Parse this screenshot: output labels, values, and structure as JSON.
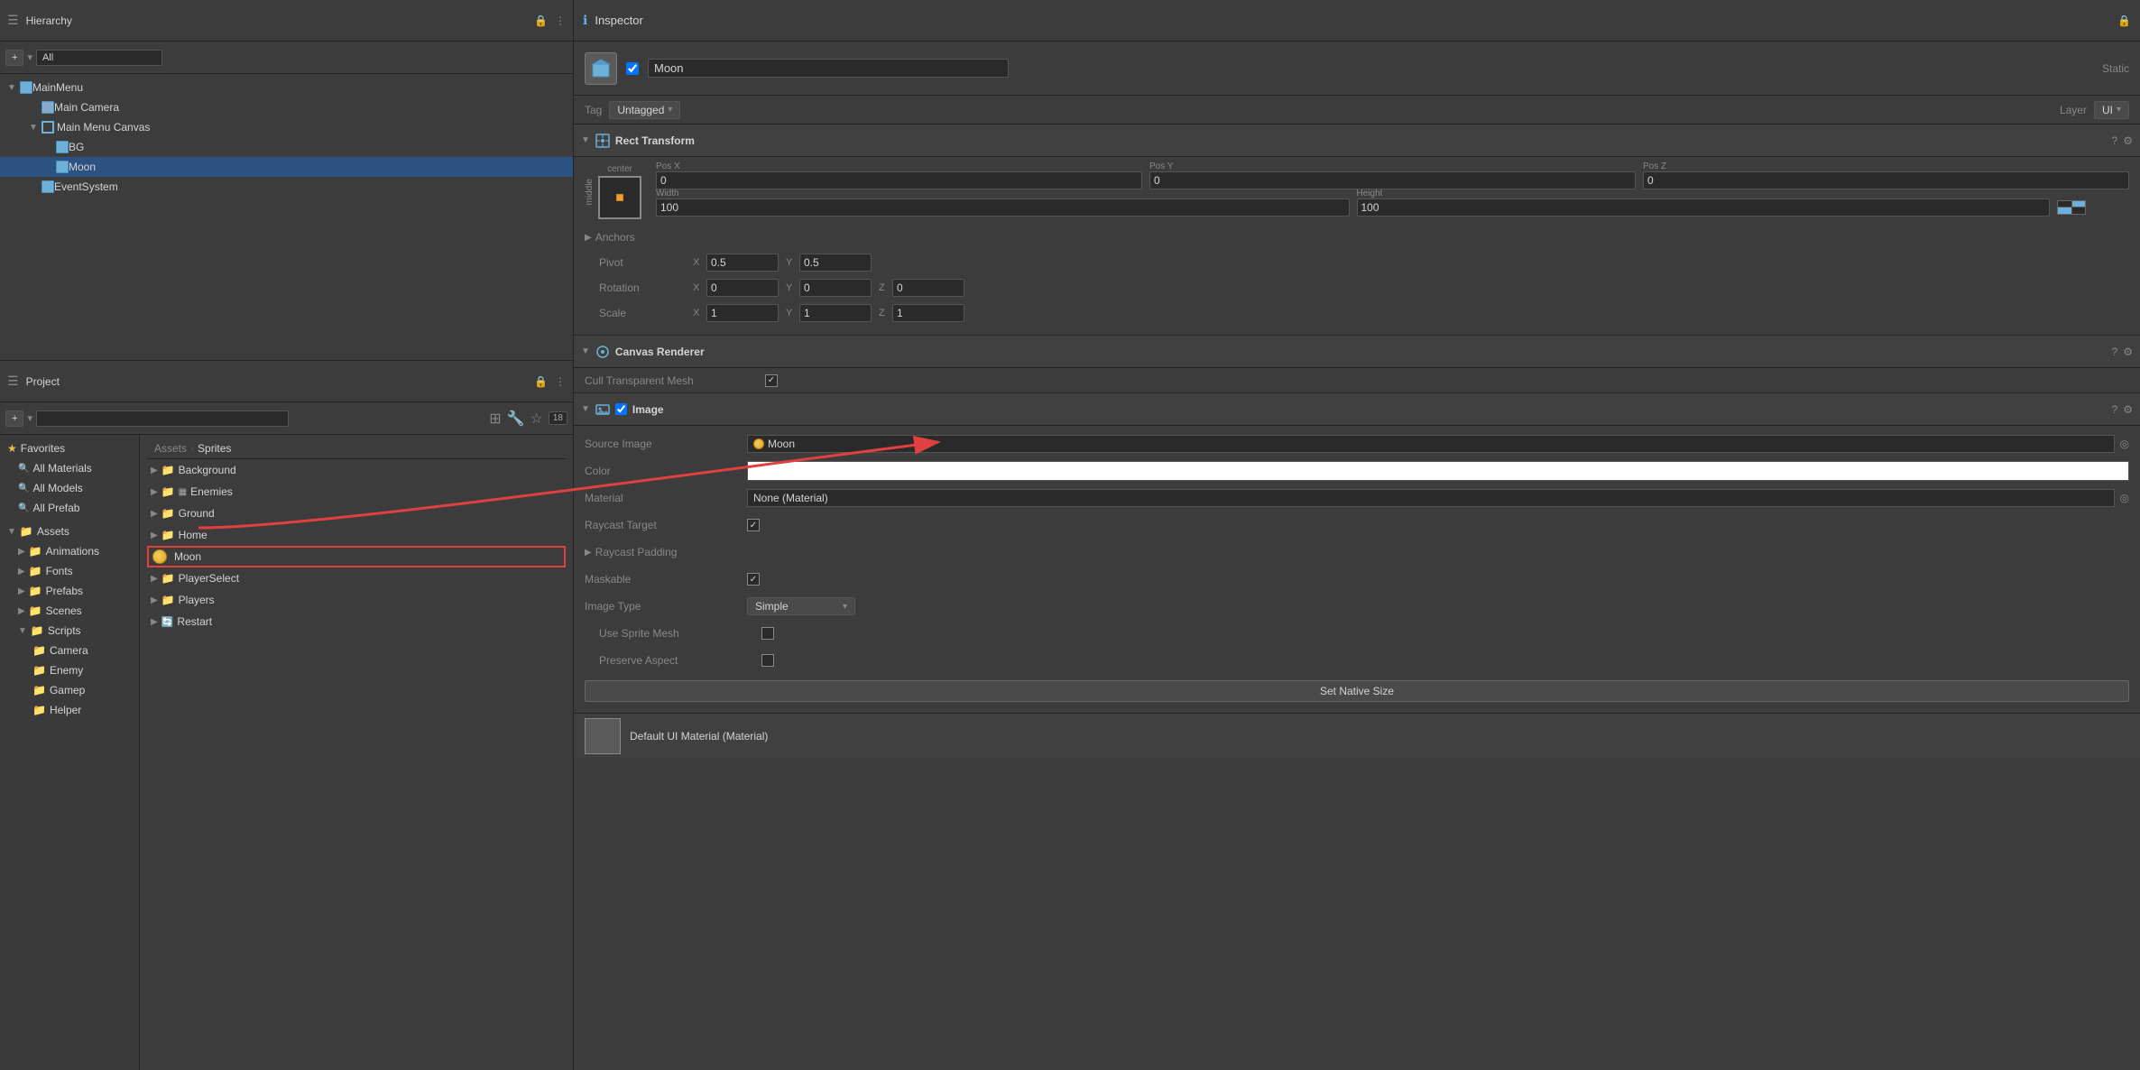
{
  "hierarchy": {
    "title": "Hierarchy",
    "toolbar": {
      "add_button": "+",
      "dropdown": "▾",
      "search_placeholder": "All"
    },
    "items": [
      {
        "id": "mainmenu",
        "label": "MainMenu",
        "indent": 0,
        "icon": "cube",
        "expanded": true,
        "selected": false
      },
      {
        "id": "maincamera",
        "label": "Main Camera",
        "indent": 1,
        "icon": "camera",
        "expanded": false,
        "selected": false
      },
      {
        "id": "mainmenucanvas",
        "label": "Main Menu Canvas",
        "indent": 1,
        "icon": "canvas",
        "expanded": true,
        "selected": false
      },
      {
        "id": "bg",
        "label": "BG",
        "indent": 2,
        "icon": "cube",
        "expanded": false,
        "selected": false
      },
      {
        "id": "moon",
        "label": "Moon",
        "indent": 2,
        "icon": "cube",
        "expanded": false,
        "selected": true
      },
      {
        "id": "eventsystem",
        "label": "EventSystem",
        "indent": 1,
        "icon": "cube",
        "expanded": false,
        "selected": false
      }
    ]
  },
  "project": {
    "title": "Project",
    "toolbar": {
      "add_button": "+",
      "dropdown": "▾",
      "search_placeholder": "",
      "badge": "18"
    },
    "breadcrumb": [
      "Assets",
      "Sprites"
    ],
    "favorites": {
      "label": "Favorites",
      "items": [
        {
          "label": "All Materials",
          "id": "all-materials"
        },
        {
          "label": "All Models",
          "id": "all-models"
        },
        {
          "label": "All Prefab",
          "id": "all-prefab"
        }
      ]
    },
    "assets": {
      "label": "Assets",
      "items": [
        {
          "label": "Animations",
          "id": "animations"
        },
        {
          "label": "Fonts",
          "id": "fonts"
        },
        {
          "label": "Prefabs",
          "id": "prefabs"
        },
        {
          "label": "Scenes",
          "id": "scenes"
        },
        {
          "label": "Scripts",
          "id": "scripts",
          "expanded": true,
          "children": [
            {
              "label": "Camera",
              "id": "camera-scripts"
            },
            {
              "label": "Enemy",
              "id": "enemy-scripts"
            },
            {
              "label": "Gamep",
              "id": "gamep-scripts"
            },
            {
              "label": "Helper",
              "id": "helper-scripts"
            }
          ]
        }
      ]
    },
    "sprites_folder": {
      "items": [
        {
          "label": "Background",
          "id": "background-folder",
          "icon": "folder"
        },
        {
          "label": "Enemies",
          "id": "enemies-folder",
          "icon": "folder"
        },
        {
          "label": "Ground",
          "id": "ground-folder",
          "icon": "folder"
        },
        {
          "label": "Home",
          "id": "home-folder",
          "icon": "folder",
          "has_sprite": true
        },
        {
          "label": "Moon",
          "id": "moon-file",
          "icon": "moon-sprite",
          "highlighted": true
        },
        {
          "label": "PlayerSelect",
          "id": "playerselect-folder",
          "icon": "folder"
        },
        {
          "label": "Players",
          "id": "players-folder",
          "icon": "folder"
        },
        {
          "label": "Restart",
          "id": "restart-folder",
          "icon": "folder"
        }
      ]
    }
  },
  "inspector": {
    "title": "Inspector",
    "object": {
      "name": "Moon",
      "enabled": true,
      "tag": "Untagged",
      "layer": "UI",
      "static_label": "Static"
    },
    "rect_transform": {
      "title": "Rect Transform",
      "anchor_label_v": "middle",
      "anchor_label_h": "center",
      "pos_x": "0",
      "pos_y": "0",
      "pos_z": "0",
      "width": "100",
      "height": "100",
      "anchors_label": "Anchors",
      "pivot_label": "Pivot",
      "pivot_x": "0.5",
      "pivot_y": "0.5",
      "rotation_label": "Rotation",
      "rotation_x": "0",
      "rotation_y": "0",
      "rotation_z": "0",
      "scale_label": "Scale",
      "scale_x": "1",
      "scale_y": "1",
      "scale_z": "1"
    },
    "canvas_renderer": {
      "title": "Canvas Renderer",
      "cull_transparent_mesh": "Cull Transparent Mesh",
      "cull_checked": true
    },
    "image": {
      "title": "Image",
      "enabled": true,
      "source_image_label": "Source Image",
      "source_image_value": "Moon",
      "color_label": "Color",
      "material_label": "Material",
      "material_value": "None (Material)",
      "raycast_target_label": "Raycast Target",
      "raycast_target_checked": true,
      "raycast_padding_label": "Raycast Padding",
      "maskable_label": "Maskable",
      "maskable_checked": true,
      "image_type_label": "Image Type",
      "image_type_value": "Simple",
      "use_sprite_mesh_label": "Use Sprite Mesh",
      "use_sprite_mesh_checked": false,
      "preserve_aspect_label": "Preserve Aspect",
      "preserve_aspect_checked": false,
      "set_native_size_btn": "Set Native Size"
    },
    "default_material": {
      "label": "Default UI Material (Material)"
    }
  }
}
